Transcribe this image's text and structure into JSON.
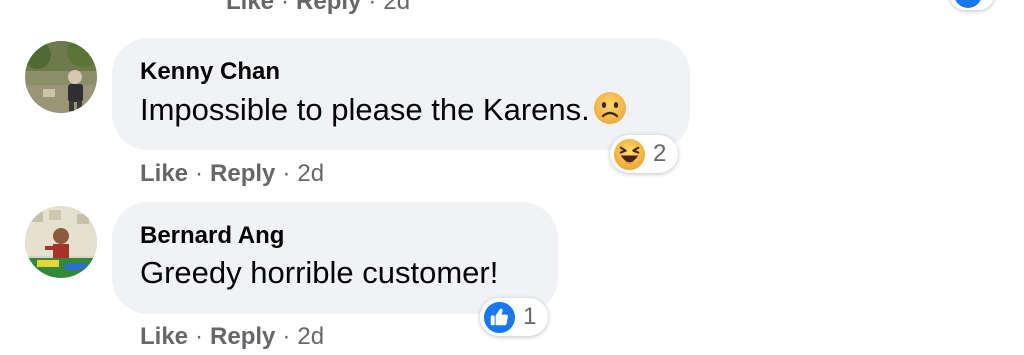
{
  "top_actions": {
    "like_label": "Like",
    "reply_label": "Reply",
    "separator": "·",
    "time": "2d"
  },
  "comments": [
    {
      "author": "Kenny Chan",
      "text": "Impossible to please the Karens.",
      "inline_emoji": "sad-face-icon",
      "reaction": {
        "icon": "haha-reaction-icon",
        "count": "2"
      },
      "actions": {
        "like_label": "Like",
        "reply_label": "Reply",
        "separator": "·",
        "time": "2d"
      }
    },
    {
      "author": "Bernard Ang",
      "text": "Greedy horrible customer!",
      "reaction": {
        "icon": "like-reaction-icon",
        "count": "1"
      },
      "actions": {
        "like_label": "Like",
        "reply_label": "Reply",
        "separator": "·",
        "time": "2d"
      }
    }
  ],
  "colors": {
    "bubble_bg": "#f0f2f5",
    "secondary_text": "#65676b",
    "primary_text": "#050505",
    "like_blue": "#1877f2",
    "haha_yellow": "#f7c244"
  }
}
